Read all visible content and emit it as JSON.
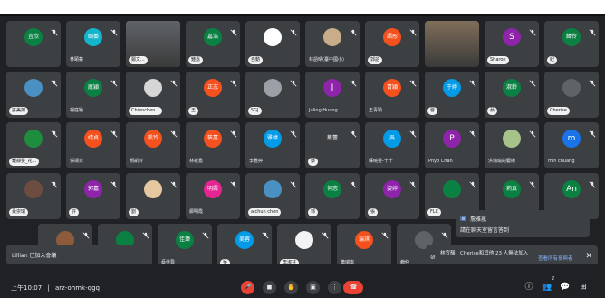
{
  "meeting": {
    "time": "上午10:07",
    "separator": "|",
    "code": "arz-ohmk-qgq",
    "bottom_right_count": "2"
  },
  "tiles": [
    {
      "id": "r1c1",
      "name": "",
      "avatar_text": "宜欣",
      "color": "#0b8043",
      "type": "avatar"
    },
    {
      "id": "r1c2",
      "name": "林頤蓁",
      "avatar_text": "頤蓁",
      "color": "#12b5cb",
      "type": "avatar",
      "plain": true
    },
    {
      "id": "r1c3",
      "name": "鄭文...",
      "avatar_text": "",
      "color": "#5f6368",
      "type": "video",
      "highlight": true
    },
    {
      "id": "r1c4",
      "name": "鍾嘉",
      "avatar_text": "嘉浩",
      "color": "#0b8043",
      "type": "avatar"
    },
    {
      "id": "r1c5",
      "name": "自動",
      "avatar_text": "",
      "color": "#ffffff",
      "type": "photo"
    },
    {
      "id": "r1c6",
      "name": "林語晴(臺中國小)",
      "avatar_text": "",
      "color": "#c9ad8b",
      "type": "photo",
      "plain": true
    },
    {
      "id": "r1c7",
      "name": "郭語",
      "avatar_text": "語彤",
      "color": "#f4511e",
      "type": "avatar"
    },
    {
      "id": "r1c8",
      "name": "",
      "avatar_text": "",
      "color": "#7f6e5a",
      "type": "video"
    },
    {
      "id": "r1c9",
      "name": "Sharon",
      "avatar_text": "S",
      "color": "#8e24aa",
      "type": "letter"
    },
    {
      "id": "r1c10",
      "name": "紀",
      "avatar_text": "緯伶",
      "color": "#0b8043",
      "type": "avatar"
    },
    {
      "id": "r2c1",
      "name": "許美如",
      "avatar_text": "",
      "color": "#4a90c2",
      "type": "photo"
    },
    {
      "id": "r2c2",
      "name": "楊庭穎",
      "avatar_text": "庭穎",
      "color": "#0b8043",
      "type": "avatar",
      "plain": true
    },
    {
      "id": "r2c3",
      "name": "Chienchen...",
      "avatar_text": "",
      "color": "#d6d6d6",
      "type": "photo"
    },
    {
      "id": "r2c4",
      "name": "王",
      "avatar_text": "正志",
      "color": "#f4511e",
      "type": "avatar"
    },
    {
      "id": "r2c5",
      "name": "SGJ",
      "avatar_text": "",
      "color": "#9aa0a6",
      "type": "photo"
    },
    {
      "id": "r2c6",
      "name": "Juling Huang",
      "avatar_text": "J",
      "color": "#8e24aa",
      "type": "letter",
      "plain": true
    },
    {
      "id": "r2c7",
      "name": "王青穎",
      "avatar_text": "青穎",
      "color": "#f4511e",
      "type": "avatar",
      "plain": true
    },
    {
      "id": "r2c8",
      "name": "曹",
      "avatar_text": "于婷",
      "color": "#039be5",
      "type": "avatar"
    },
    {
      "id": "r2c9",
      "name": "蔡",
      "avatar_text": "淑鈴",
      "color": "#0b8043",
      "type": "avatar"
    },
    {
      "id": "r2c10",
      "name": "Cherise",
      "avatar_text": "",
      "color": "#5f6368",
      "type": "photo"
    },
    {
      "id": "r3c1",
      "name": "鍾靜雯_花...",
      "avatar_text": "",
      "color": "#1e8e3e",
      "type": "photo"
    },
    {
      "id": "r3c2",
      "name": "張靖貞",
      "avatar_text": "靖貞",
      "color": "#f4511e",
      "type": "avatar",
      "plain": true
    },
    {
      "id": "r3c3",
      "name": "顏凱玲",
      "avatar_text": "凱玲",
      "color": "#f4511e",
      "type": "avatar",
      "plain": true
    },
    {
      "id": "r3c4",
      "name": "林筱嘉",
      "avatar_text": "筱嘉",
      "color": "#f4511e",
      "type": "avatar",
      "plain": true
    },
    {
      "id": "r3c5",
      "name": "李雅婷",
      "avatar_text": "雅婷",
      "color": "#039be5",
      "type": "avatar",
      "plain": true
    },
    {
      "id": "r3c6",
      "name": "蔡",
      "avatar_text": "蔡蕾",
      "color": "#3c4043",
      "type": "avatar"
    },
    {
      "id": "r3c7",
      "name": "蘇曉雯-十十",
      "avatar_text": "吳",
      "color": "#039be5",
      "type": "avatar",
      "plain": true
    },
    {
      "id": "r3c8",
      "name": "Phyo Chan",
      "avatar_text": "P",
      "color": "#8e24aa",
      "type": "letter",
      "plain": true
    },
    {
      "id": "r3c9",
      "name": "洪瑞瑜的藝術",
      "avatar_text": "",
      "color": "#a6c48a",
      "type": "photo",
      "plain": true
    },
    {
      "id": "r3c10",
      "name": "min chuang",
      "avatar_text": "m",
      "color": "#1a73e8",
      "type": "letter",
      "plain": true
    },
    {
      "id": "r4c1",
      "name": "黃崇瑞",
      "avatar_text": "",
      "color": "#6d4c41",
      "type": "photo"
    },
    {
      "id": "r4c2",
      "name": "許",
      "avatar_text": "郭嘉",
      "color": "#8e24aa",
      "type": "avatar"
    },
    {
      "id": "r4c3",
      "name": "劉",
      "avatar_text": "",
      "color": "#e6c8a0",
      "type": "photo"
    },
    {
      "id": "r4c4",
      "name": "鄭明霞",
      "avatar_text": "明霞",
      "color": "#e52592",
      "type": "avatar",
      "plain": true
    },
    {
      "id": "r4c5",
      "name": "alchun chen",
      "avatar_text": "",
      "color": "#4a90c2",
      "type": "photo"
    },
    {
      "id": "r4c6",
      "name": "郭",
      "avatar_text": "何志",
      "color": "#0b8043",
      "type": "avatar"
    },
    {
      "id": "r4c7",
      "name": "張",
      "avatar_text": "姿婷",
      "color": "#8e24aa",
      "type": "avatar"
    },
    {
      "id": "r4c8",
      "name": "FLC",
      "avatar_text": "",
      "color": "#0b8043",
      "type": "photo"
    },
    {
      "id": "r4c9",
      "name": "",
      "avatar_text": "莉真",
      "color": "#0b8043",
      "type": "avatar"
    },
    {
      "id": "r4c10",
      "name": "",
      "avatar_text": "An",
      "color": "#0b8043",
      "type": "letter"
    },
    {
      "id": "r5c1",
      "name": "",
      "avatar_text": "",
      "color": "#8e5b3a",
      "type": "photo"
    },
    {
      "id": "r5c2",
      "name": "",
      "avatar_text": "",
      "color": "#0b8043",
      "type": "photo"
    },
    {
      "id": "r5c3",
      "name": "蔡佳蓉",
      "avatar_text": "佳瑋",
      "color": "#0b8043",
      "type": "avatar",
      "plain": true
    },
    {
      "id": "r5c4",
      "name": "吳",
      "avatar_text": "美蓉",
      "color": "#039be5",
      "type": "avatar"
    },
    {
      "id": "r5c5",
      "name": "李淑芬",
      "avatar_text": "",
      "color": "#f1f3f4",
      "type": "photo"
    },
    {
      "id": "r5c6",
      "name": "蕭瑞琪",
      "avatar_text": "瑞琪",
      "color": "#f4511e",
      "type": "avatar",
      "plain": true
    },
    {
      "id": "r5c7",
      "name": "賴仲",
      "avatar_text": "",
      "color": "#5f6368",
      "type": "photo",
      "plain": true
    }
  ],
  "toast_left": {
    "text": "Lillian 已加入會議"
  },
  "toast_chat": {
    "title": "詹雅嵐",
    "message": "請在聊天室留言答到"
  },
  "toast_join": {
    "text": "林宜靜、Cherise和其他 23 人無法加入",
    "action": "查看所有參與者"
  },
  "controls": [
    {
      "id": "mic",
      "glyph": "🎤",
      "red": true
    },
    {
      "id": "cam",
      "glyph": "◼",
      "red": false
    },
    {
      "id": "hand",
      "glyph": "✋",
      "red": false
    },
    {
      "id": "present",
      "glyph": "▣",
      "red": false
    },
    {
      "id": "more",
      "glyph": "⋮",
      "red": false
    }
  ],
  "right_controls": [
    {
      "id": "info",
      "glyph": "ⓘ"
    },
    {
      "id": "people",
      "glyph": "👥"
    },
    {
      "id": "chat",
      "glyph": "💬"
    },
    {
      "id": "activities",
      "glyph": "⊞"
    }
  ],
  "colors": {
    "bg": "#202124",
    "tile": "#3c4043",
    "accent": "#8ab4f8",
    "red": "#ea4335"
  }
}
